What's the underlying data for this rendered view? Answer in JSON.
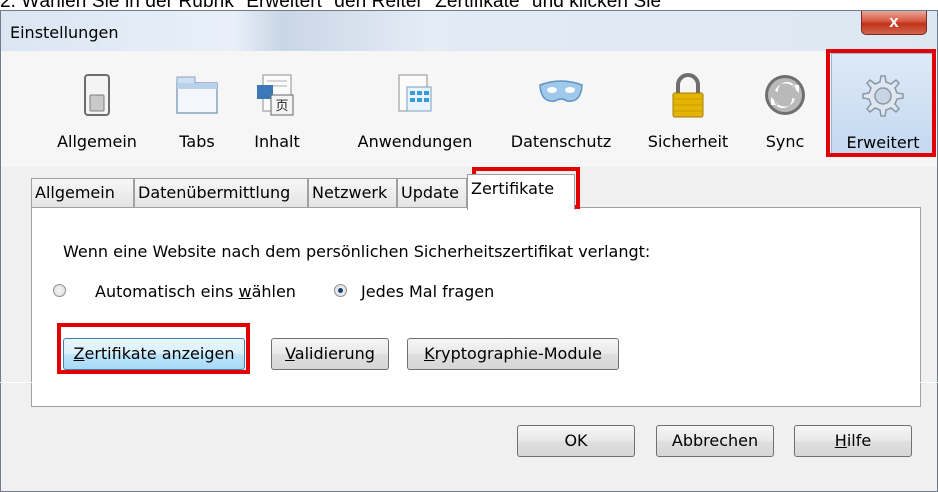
{
  "caption": "2.   Wählen Sie in der Rubrik \"Erweitert\" den Reiter \"Zertifikate\" und klicken Sie",
  "window": {
    "title": "Einstellungen",
    "close_glyph": "x"
  },
  "toolbar": {
    "items": [
      {
        "label": "Allgemein",
        "icon": "switch-icon"
      },
      {
        "label": "Tabs",
        "icon": "tabs-icon"
      },
      {
        "label": "Inhalt",
        "icon": "content-icon"
      },
      {
        "label": "Anwendungen",
        "icon": "applications-icon"
      },
      {
        "label": "Datenschutz",
        "icon": "mask-icon"
      },
      {
        "label": "Sicherheit",
        "icon": "padlock-icon"
      },
      {
        "label": "Sync",
        "icon": "sync-icon"
      },
      {
        "label": "Erweitert",
        "icon": "gear-icon",
        "selected": true
      }
    ]
  },
  "subtabs": [
    {
      "label": "Allgemein"
    },
    {
      "label": "Datenübermittlung"
    },
    {
      "label": "Netzwerk"
    },
    {
      "label": "Update"
    },
    {
      "label": "Zertifikate",
      "selected": true
    }
  ],
  "panel": {
    "prompt": "Wenn eine Website nach dem persönlichen Sicherheitszertifikat verlangt:",
    "radio_auto": {
      "before": "Automatisch eins ",
      "accel": "w",
      "after": "ählen",
      "checked": false
    },
    "radio_ask": {
      "before": "",
      "accel": "J",
      "after": "edes Mal fragen",
      "checked": true
    },
    "buttons": {
      "show_certs": {
        "accel": "Z",
        "after": "ertifikate anzeigen"
      },
      "validation": {
        "accel": "V",
        "after": "alidierung"
      },
      "crypto": {
        "accel": "K",
        "after": "ryptographie-Module"
      }
    }
  },
  "footer": {
    "ok": "OK",
    "cancel": "Abbrechen",
    "help": {
      "accel": "H",
      "after": "ilfe"
    }
  },
  "colors": {
    "highlight": "#e30000",
    "selected_bg": "#c4d8f0",
    "dialog_bg": "#f0f0f0"
  }
}
